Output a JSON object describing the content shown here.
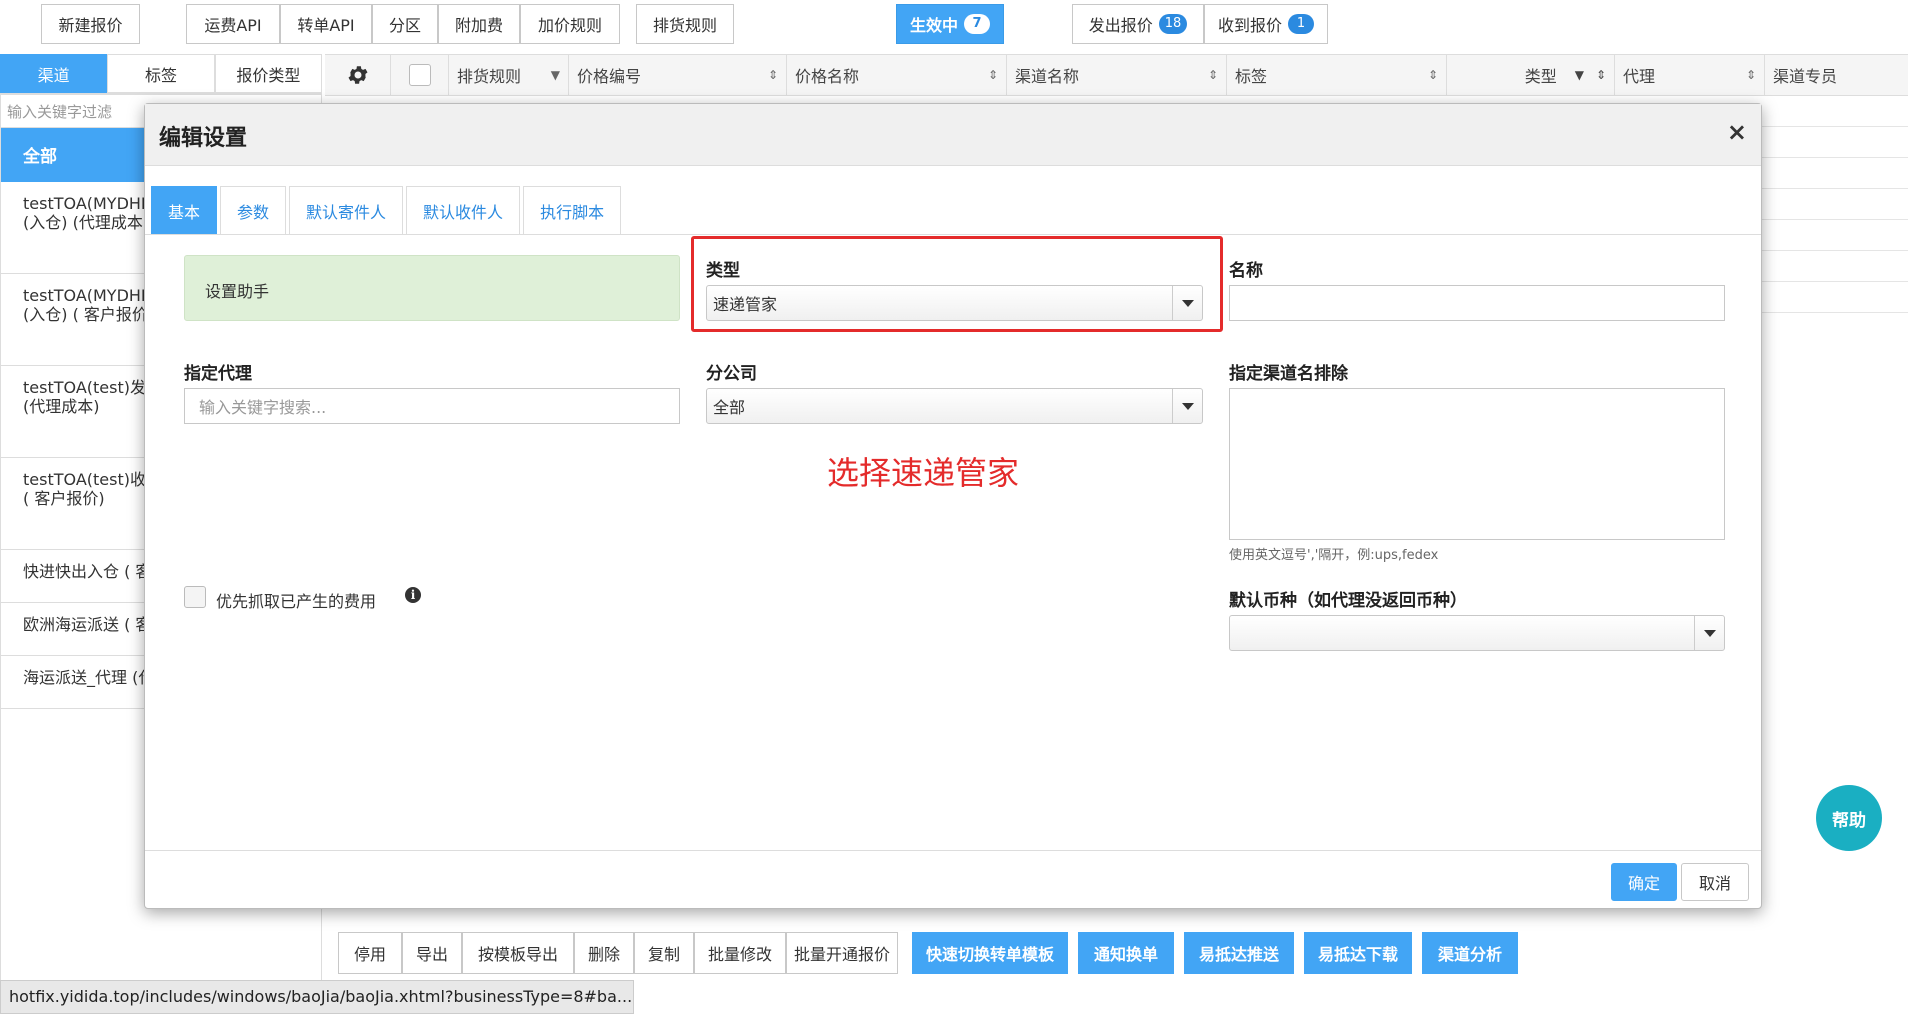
{
  "topbar": {
    "new_quote": "新建报价",
    "group1": [
      "运费API",
      "转单API",
      "分区",
      "附加费",
      "加价规则"
    ],
    "cargo_rules": "排货规则",
    "active": {
      "label": "生效中",
      "count": "7"
    },
    "sent": {
      "label": "发出报价",
      "count": "18"
    },
    "received": {
      "label": "收到报价",
      "count": "1"
    }
  },
  "left": {
    "tabs": [
      "渠道",
      "标签",
      "报价类型"
    ],
    "filter_placeholder": "输入关键字过滤",
    "all_label": "全部",
    "items": [
      "testTOA(MYDHL\n(入仓) (代理成本)",
      "testTOA(MYDHL\n(入仓) ( 客户报价",
      "testTOA(test)发货\n(代理成本)",
      "testTOA(test)收货\n( 客户报价)",
      "快进快出入仓 ( 客",
      "欧洲海运派送 ( 客",
      "海运派送_代理 (代"
    ]
  },
  "grid": {
    "headers": [
      "排货规则",
      "价格编号",
      "价格名称",
      "渠道名称",
      "标签",
      "类型",
      "代理",
      "渠道专员"
    ]
  },
  "bottom": {
    "buttons": [
      "停用",
      "导出",
      "按模板导出",
      "删除",
      "复制",
      "批量修改",
      "批量开通报价"
    ],
    "blue_buttons": [
      "快速切换转单模板",
      "通知换单",
      "易抵达推送",
      "易抵达下载",
      "渠道分析"
    ]
  },
  "url": "hotfix.yidida.top/includes/windows/baoJia/baoJia.xhtml?businessType=8#ba...",
  "modal": {
    "title": "编辑设置",
    "close": "×",
    "tabs": [
      "基本",
      "参数",
      "默认寄件人",
      "默认收件人",
      "执行脚本"
    ],
    "helper": "设置助手",
    "type_label": "类型",
    "type_value": "速递管家",
    "name_label": "名称",
    "name_value": "",
    "agent_label": "指定代理",
    "agent_placeholder": "输入关键字搜索...",
    "branch_label": "分公司",
    "branch_value": "全部",
    "exclude_label": "指定渠道名排除",
    "exclude_hint": "使用英文逗号','隔开，例:ups,fedex",
    "priority_label": "优先抓取已产生的费用",
    "info_icon": "i",
    "currency_label": "默认币种（如代理没返回币种）",
    "currency_value": "",
    "annotation": "选择速递管家",
    "ok": "确定",
    "cancel": "取消"
  },
  "help": "帮助",
  "colors": {
    "accent": "#42a5f5",
    "annotation": "#e42b2b",
    "help": "#1aafc2",
    "helper_bg": "#dff0d8"
  }
}
